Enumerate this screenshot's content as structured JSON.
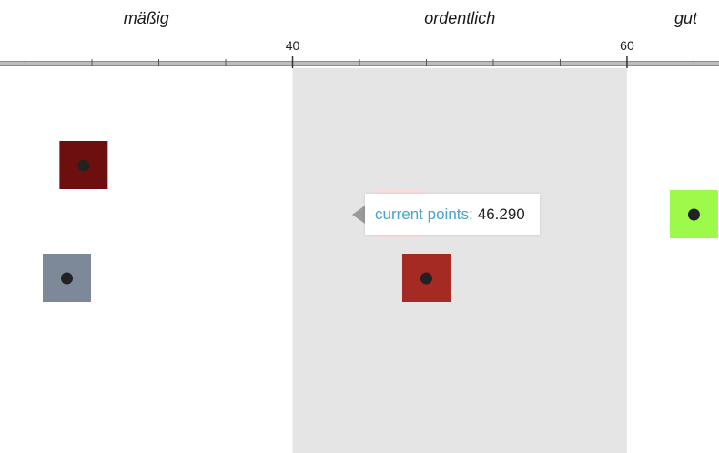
{
  "chart_data": {
    "type": "scatter",
    "x_domain": [
      22.5,
      65.5
    ],
    "bands": [
      {
        "label": "mäßig",
        "from": 22.5,
        "to": 40,
        "shaded": false
      },
      {
        "label": "ordentlich",
        "from": 40,
        "to": 60,
        "shaded": true
      },
      {
        "label": "gut",
        "from": 60,
        "to": 65.5,
        "shaded": false
      }
    ],
    "major_ticks": [
      {
        "value": 40,
        "label": "40"
      },
      {
        "value": 60,
        "label": "60"
      }
    ],
    "minor_tick_step": 4,
    "points": [
      {
        "x": 27.5,
        "row": 2,
        "color": "#6e0f0f"
      },
      {
        "x": 46.29,
        "row": 3,
        "color": "#f9dcdc",
        "selected": true
      },
      {
        "x": 64.0,
        "row": 3,
        "color": "#9dfa4a"
      },
      {
        "x": 26.5,
        "row": 4,
        "color": "#7d8899"
      },
      {
        "x": 48.0,
        "row": 4,
        "color": "#a52a24"
      }
    ],
    "colors": {
      "shaded_band": "#e5e5e5",
      "axis": "#999999",
      "point_center": "#222222"
    }
  },
  "tooltip": {
    "label": "current points:",
    "value": "46.290"
  }
}
